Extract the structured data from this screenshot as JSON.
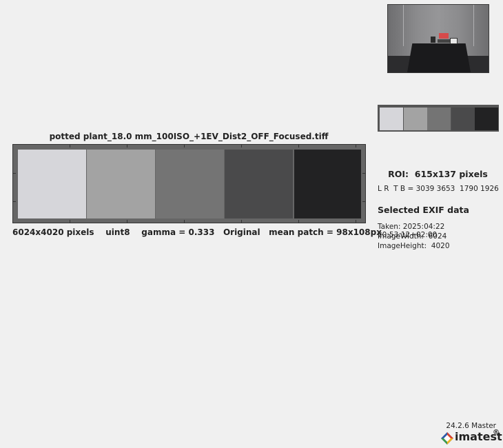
{
  "image": {
    "title": "potted plant_18.0 mm_100ISO_+1EV_Dist2_OFF_Focused.tiff",
    "footer": "6024x4020 pixels    uint8    gamma = 0.333   Original   mean patch = 98x108px",
    "patch_colors": [
      "#d6d6da",
      "#a3a3a3",
      "#747474",
      "#4a4a4b",
      "#222223"
    ],
    "frame_color": "#666666"
  },
  "mini_strip": {
    "patch_colors": [
      "#d6d6da",
      "#a3a3a3",
      "#747474",
      "#4a4a4b",
      "#222223"
    ]
  },
  "roi": {
    "label": "ROI:  615x137 pixels",
    "lrtb": "L R  T B = 3039 3653  1790 1926"
  },
  "exif": {
    "heading": "Selected EXIF data",
    "lines": [
      "Taken: 2025:04:22 20:53:12+02:00",
      "ImageWidth:  6024",
      "ImageHeight:  4020"
    ]
  },
  "branding": {
    "version": "24.2.6 Master",
    "logo_text": "imatest",
    "logo_reg": "®"
  }
}
